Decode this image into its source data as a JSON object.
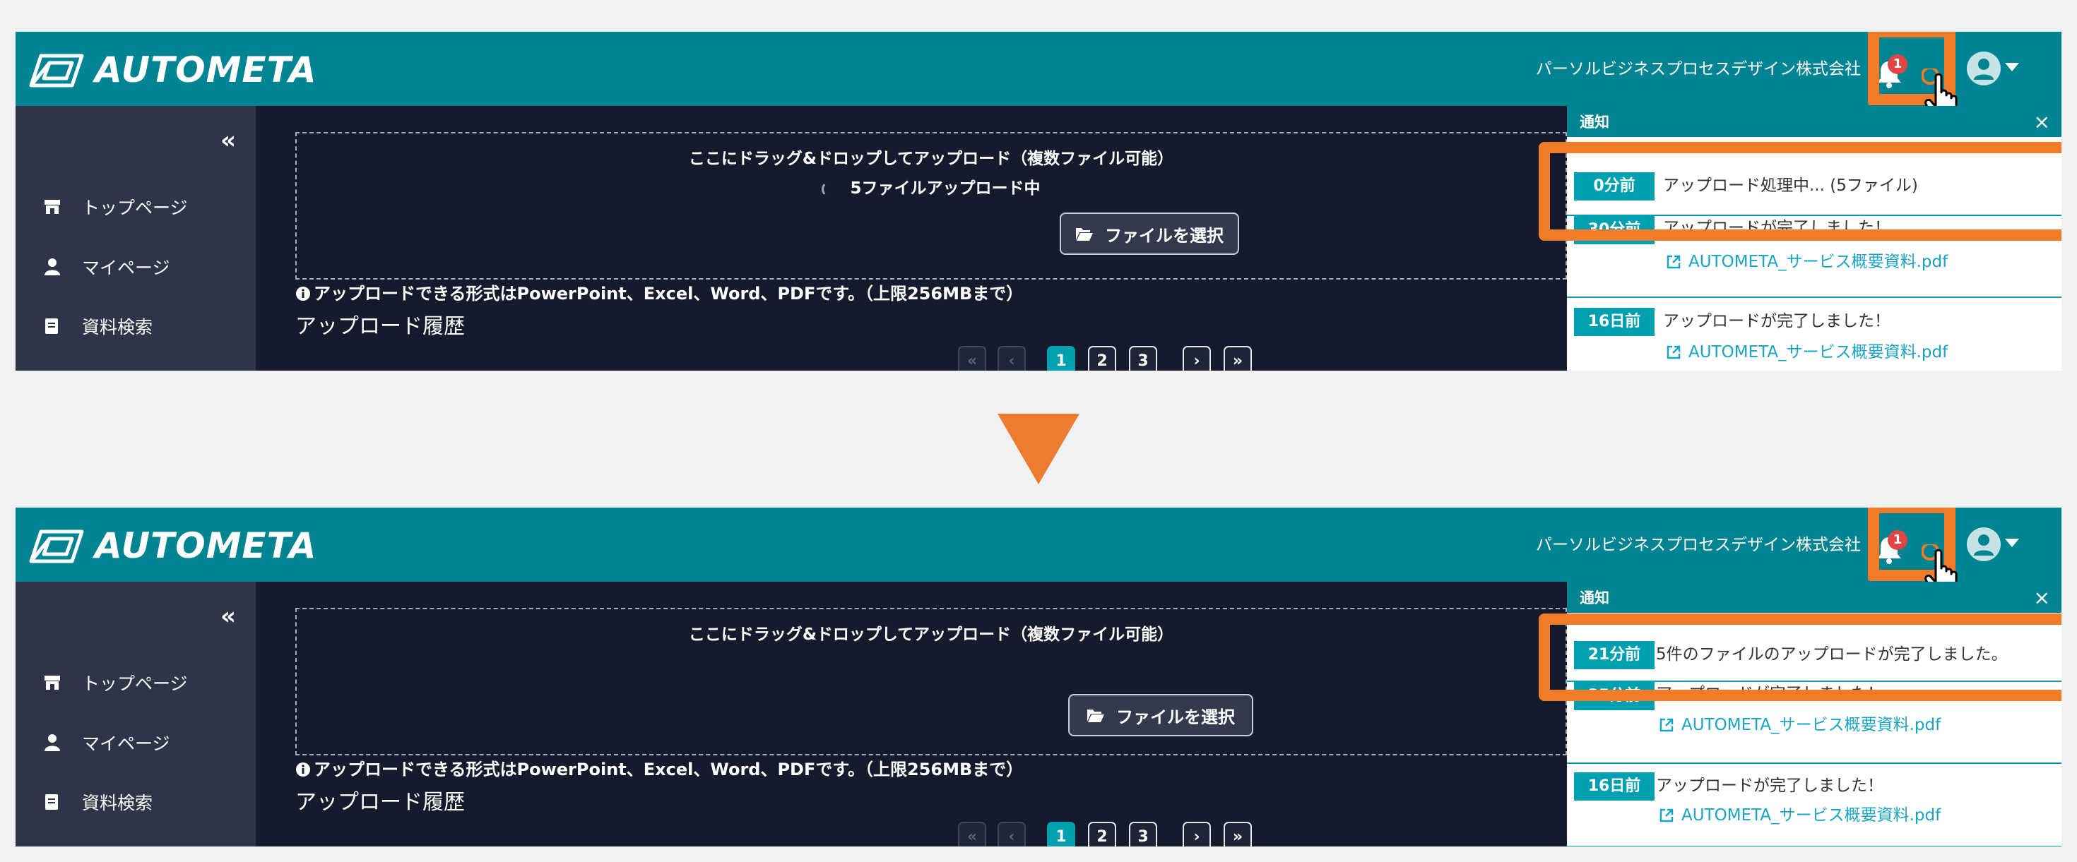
{
  "brand": {
    "name": "AUTOMETA"
  },
  "header": {
    "company": "パーソルビジネスプロセスデザイン株式会社",
    "notification_count": "1"
  },
  "sidebar": {
    "collapse": "«",
    "items": [
      {
        "label": "トップページ",
        "icon": "store-icon"
      },
      {
        "label": "マイページ",
        "icon": "user-icon"
      },
      {
        "label": "資料検索",
        "icon": "document-icon"
      }
    ]
  },
  "upload": {
    "drop_text": "ここにドラッグ&ドロップしてアップロード（複数ファイル可能）",
    "uploading_text": "5ファイルアップロード中",
    "select_button": "ファイルを選択",
    "note": "アップロードできる形式はPowerPoint、Excel、Word、PDFです。（上限256MBまで）"
  },
  "history": {
    "title": "アップロード履歴"
  },
  "pagination": {
    "first": "«",
    "prev": "‹",
    "pages": [
      "1",
      "2",
      "3"
    ],
    "next": "›",
    "last": "»",
    "active_page": "1"
  },
  "notifications_before": {
    "title": "通知",
    "close": "×",
    "items": [
      {
        "ago": "0分前",
        "message": "アップロード処理中... (5ファイル)"
      },
      {
        "ago": "30分前",
        "message": "アップロードが完了しました！",
        "link": "AUTOMETA_サービス概要資料.pdf"
      },
      {
        "ago": "16日前",
        "message": "アップロードが完了しました！",
        "link": "AUTOMETA_サービス概要資料.pdf"
      }
    ]
  },
  "notifications_after": {
    "title": "通知",
    "close": "×",
    "items": [
      {
        "ago": "21分前",
        "message": "5件のファイルのアップロードが完了しました。"
      },
      {
        "ago": "35分前",
        "message": "アップロードが完了しました！",
        "link": "AUTOMETA_サービス概要資料.pdf"
      },
      {
        "ago": "16日前",
        "message": "アップロードが完了しました！",
        "link": "AUTOMETA_サービス概要資料.pdf"
      }
    ]
  },
  "colors": {
    "header": "#008492",
    "accent": "#00a0b0",
    "highlight": "#f07c2a",
    "sidebar": "#2e3549",
    "main": "#161a2d"
  }
}
